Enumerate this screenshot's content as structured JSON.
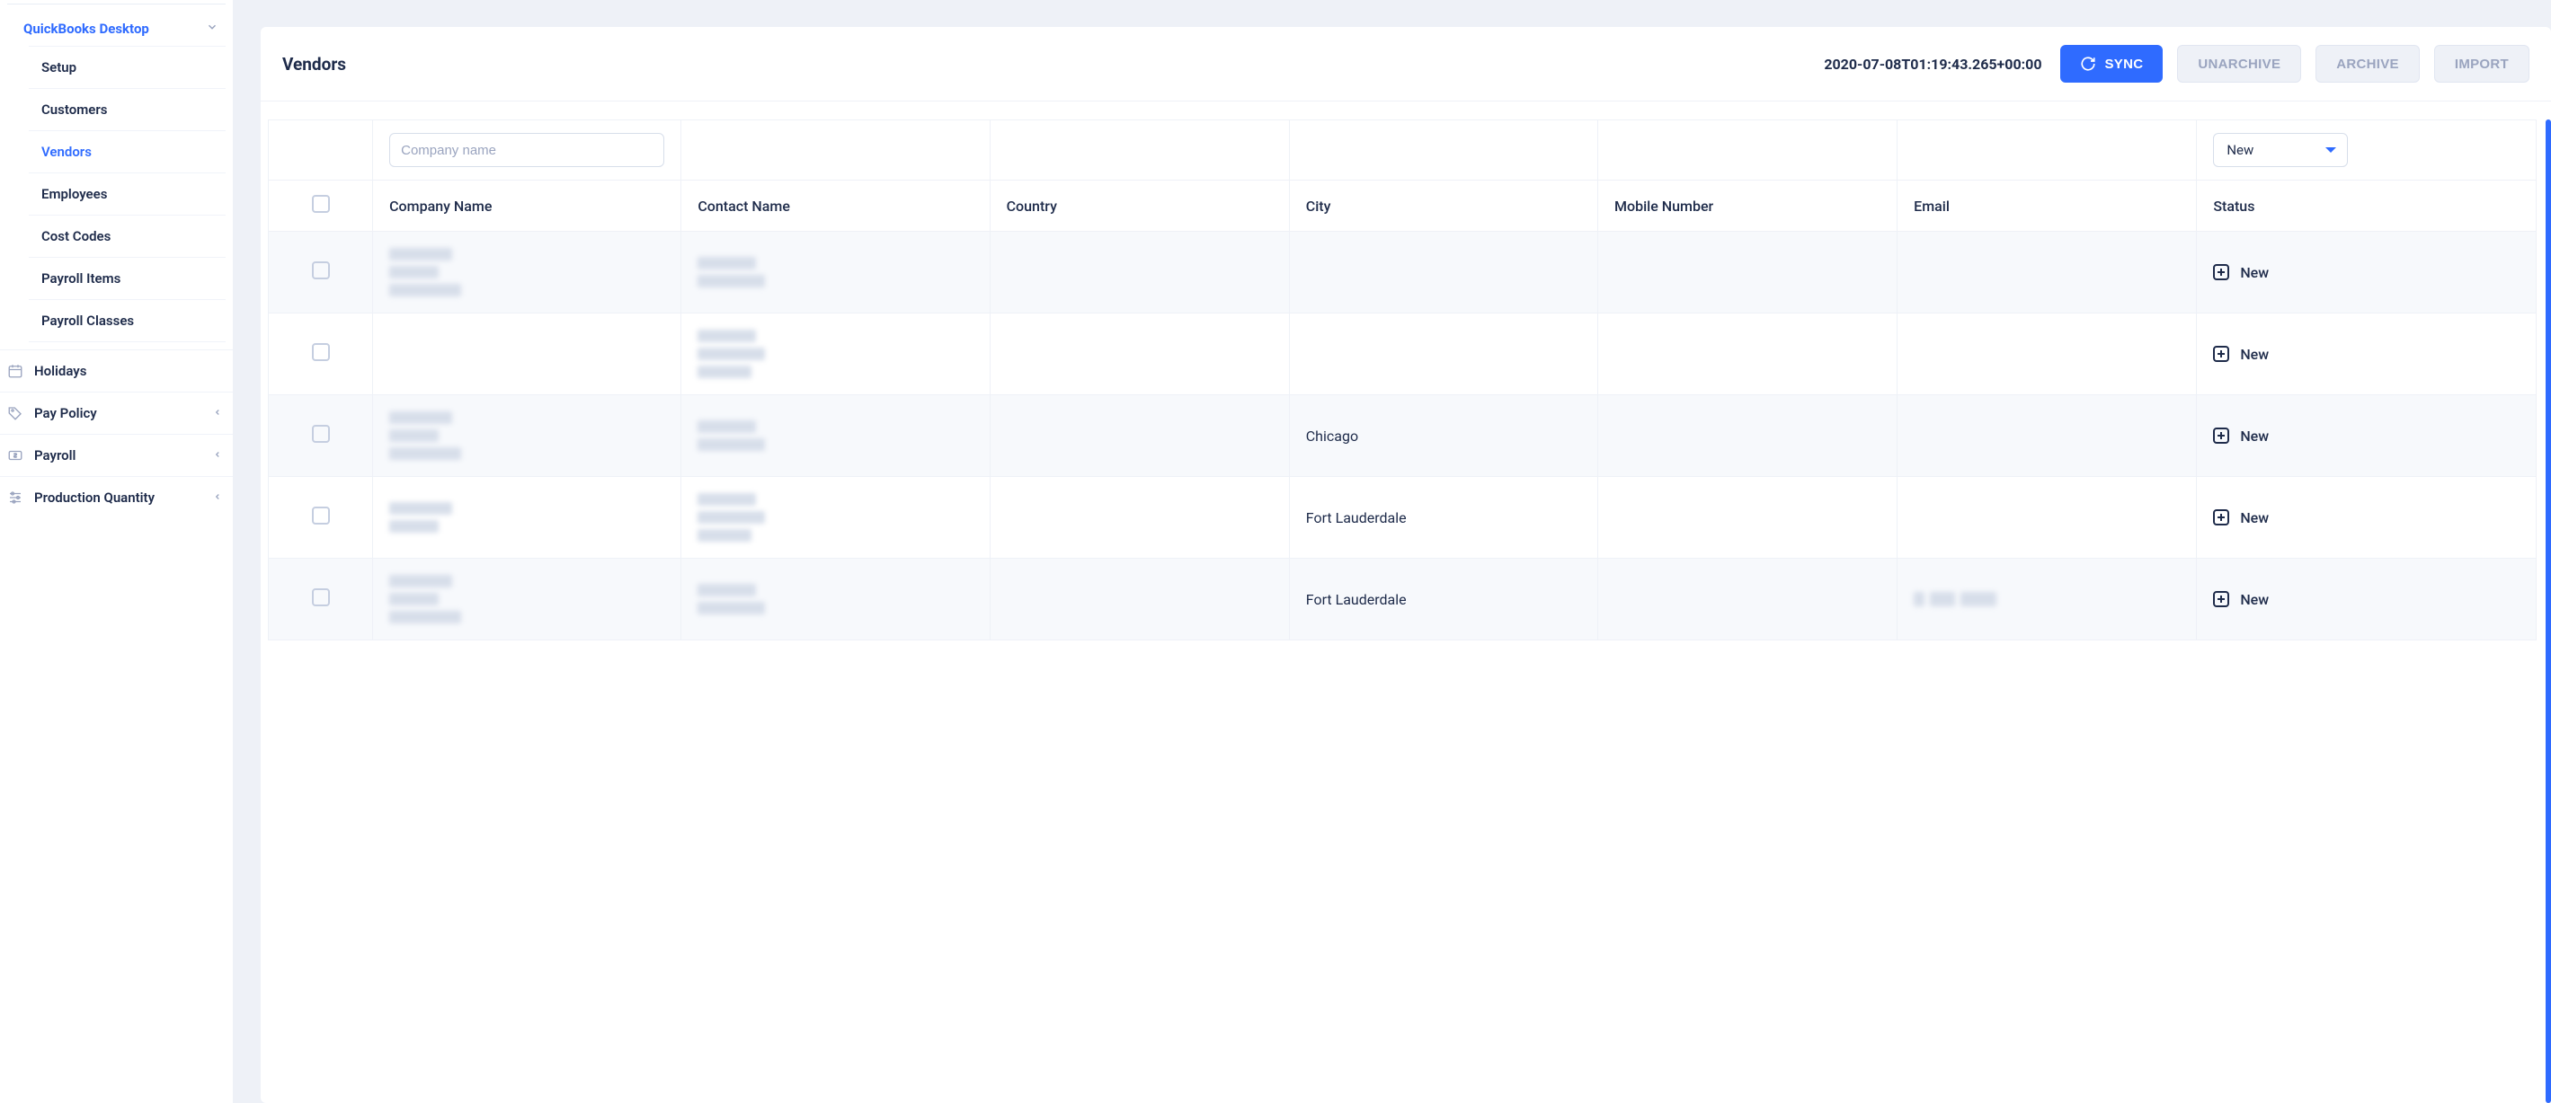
{
  "sidebar": {
    "group_label": "QuickBooks Desktop",
    "sub_items": [
      {
        "label": "Setup",
        "active": false
      },
      {
        "label": "Customers",
        "active": false
      },
      {
        "label": "Vendors",
        "active": true
      },
      {
        "label": "Employees",
        "active": false
      },
      {
        "label": "Cost Codes",
        "active": false
      },
      {
        "label": "Payroll Items",
        "active": false
      },
      {
        "label": "Payroll Classes",
        "active": false
      }
    ],
    "nav": [
      {
        "label": "Holidays",
        "icon": "calendar-icon",
        "expandable": false
      },
      {
        "label": "Pay Policy",
        "icon": "tag-icon",
        "expandable": true
      },
      {
        "label": "Payroll",
        "icon": "money-icon",
        "expandable": true
      },
      {
        "label": "Production Quantity",
        "icon": "sliders-icon",
        "expandable": true
      }
    ]
  },
  "header": {
    "title": "Vendors",
    "timestamp": "2020-07-08T01:19:43.265+00:00",
    "sync_label": "SYNC",
    "unarchive_label": "UNARCHIVE",
    "archive_label": "ARCHIVE",
    "import_label": "IMPORT"
  },
  "table": {
    "filter_company_placeholder": "Company name",
    "filter_status_value": "New",
    "columns": [
      "Company Name",
      "Contact Name",
      "Country",
      "City",
      "Mobile Number",
      "Email",
      "Status"
    ],
    "rows": [
      {
        "company": "",
        "contact": "",
        "country": "",
        "city": "",
        "mobile": "",
        "email": "",
        "status": "New"
      },
      {
        "company": "",
        "contact": "",
        "country": "",
        "city": "",
        "mobile": "",
        "email": "",
        "status": "New"
      },
      {
        "company": "",
        "contact": "",
        "country": "",
        "city": "Chicago",
        "mobile": "",
        "email": "",
        "status": "New"
      },
      {
        "company": "",
        "contact": "",
        "country": "",
        "city": "Fort Lauderdale",
        "mobile": "",
        "email": "",
        "status": "New"
      },
      {
        "company": "",
        "contact": "",
        "country": "",
        "city": "Fort Lauderdale",
        "mobile": "",
        "email": "",
        "status": "New"
      }
    ]
  }
}
